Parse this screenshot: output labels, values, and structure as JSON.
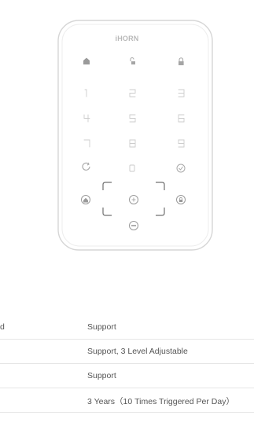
{
  "product": {
    "brand": "iHORN",
    "keys_row1": [
      "1",
      "2",
      "3"
    ],
    "keys_row2": [
      "4",
      "5",
      "6"
    ],
    "keys_row3": [
      "7",
      "8",
      "9"
    ],
    "top_icons": [
      "home-icon",
      "unlock-icon",
      "lock-icon"
    ],
    "function_icons": [
      "refresh-icon",
      "zero-key-icon",
      "check-icon"
    ],
    "side_icons": [
      "sos-home-icon",
      "card-reader-icon",
      "lock-circle-icon",
      "sos-icon"
    ]
  },
  "specs": {
    "rows": [
      {
        "label": "d",
        "value": "Support"
      },
      {
        "label": "",
        "value": "Support, 3 Level Adjustable"
      },
      {
        "label": "",
        "value": "Support"
      },
      {
        "label": "",
        "value": "3 Years（10 Times Triggered Per Day）"
      }
    ]
  }
}
